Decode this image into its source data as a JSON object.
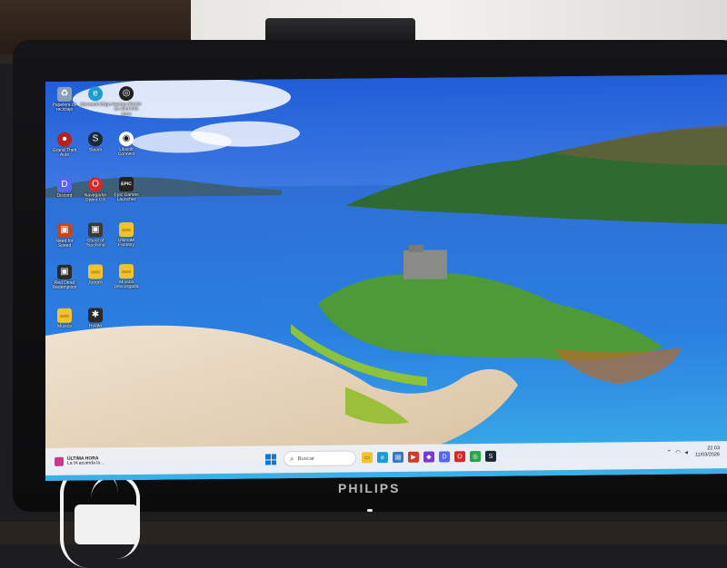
{
  "desktop": {
    "icons": [
      {
        "id": "recycle",
        "label": "Papelera de reciclaje",
        "icon": "recycle-bin-icon",
        "color": "#8aa0b8",
        "glyph": "♻"
      },
      {
        "id": "edge",
        "label": "Microsoft Edge",
        "icon": "edge-icon",
        "color": "#1e9ad6",
        "glyph": "e"
      },
      {
        "id": "shortcut3",
        "label": "Acceso directo de diferente otros",
        "icon": "app-icon",
        "color": "#202020",
        "glyph": "◎"
      },
      {
        "id": "origin",
        "label": "Grand Theft Auto",
        "icon": "game-icon",
        "color": "#b52020",
        "glyph": "●"
      },
      {
        "id": "steam",
        "label": "Steam",
        "icon": "steam-icon",
        "color": "#1b2838",
        "glyph": "S"
      },
      {
        "id": "ubisoft",
        "label": "Ubisoft Connect",
        "icon": "ubisoft-icon",
        "color": "#ffffff",
        "glyph": "◉"
      },
      {
        "id": "discord",
        "label": "Discord",
        "icon": "discord-icon",
        "color": "#5865f2",
        "glyph": "D"
      },
      {
        "id": "opera",
        "label": "Navegador Opera GX",
        "icon": "opera-gx-icon",
        "color": "#d22a2a",
        "glyph": "O"
      },
      {
        "id": "epic",
        "label": "Epic Games Launcher",
        "icon": "epic-games-icon",
        "color": "#222222",
        "glyph": "EPIC"
      },
      {
        "id": "game1",
        "label": "Need for Speed",
        "icon": "game-icon",
        "color": "#c4461a",
        "glyph": "▣"
      },
      {
        "id": "game2",
        "label": "Ghost of Tsushima",
        "icon": "game-icon",
        "color": "#3a3a3a",
        "glyph": "▣"
      },
      {
        "id": "folder1",
        "label": "Ultimate Fantasy",
        "icon": "folder-icon",
        "color": "#f2c230",
        "glyph": "▬"
      },
      {
        "id": "game3",
        "label": "Red Dead Redemption",
        "icon": "game-icon",
        "color": "#2a2a2a",
        "glyph": "▣"
      },
      {
        "id": "folder2",
        "label": "Música",
        "icon": "folder-icon",
        "color": "#f2c230",
        "glyph": "▬"
      },
      {
        "id": "folder3",
        "label": "Juegos",
        "icon": "folder-icon",
        "color": "#f2c230",
        "glyph": "▬"
      },
      {
        "id": "folder4",
        "label": "Música Descargada",
        "icon": "folder-icon",
        "color": "#f2c230",
        "glyph": "▬"
      },
      {
        "id": "spider",
        "label": "Hytale",
        "icon": "spider-icon",
        "color": "#2a2a2a",
        "glyph": "✱"
      }
    ]
  },
  "taskbar": {
    "news_title": "ÚLTIMA HORA",
    "news_text": "La IA acuerda la ...",
    "search_placeholder": "Buscar",
    "apps": [
      {
        "name": "file-explorer-icon",
        "color": "#f2c230",
        "glyph": "▭"
      },
      {
        "name": "edge-taskbar-icon",
        "color": "#1e9ad6",
        "glyph": "e"
      },
      {
        "name": "store-icon",
        "color": "#3a78c9",
        "glyph": "▤"
      },
      {
        "name": "game-taskbar-icon",
        "color": "#d23a2a",
        "glyph": "▶"
      },
      {
        "name": "app-taskbar-icon",
        "color": "#7a3ac9",
        "glyph": "◆"
      },
      {
        "name": "discord-taskbar-icon",
        "color": "#5865f2",
        "glyph": "D"
      },
      {
        "name": "opera-taskbar-icon",
        "color": "#d22a2a",
        "glyph": "O"
      },
      {
        "name": "chrome-icon",
        "color": "#2aa34a",
        "glyph": "◎"
      },
      {
        "name": "steam-taskbar-icon",
        "color": "#1b2838",
        "glyph": "S"
      }
    ],
    "time": "22:03",
    "date": "11/03/2026"
  },
  "monitor": {
    "brand": "PHILIPS"
  }
}
